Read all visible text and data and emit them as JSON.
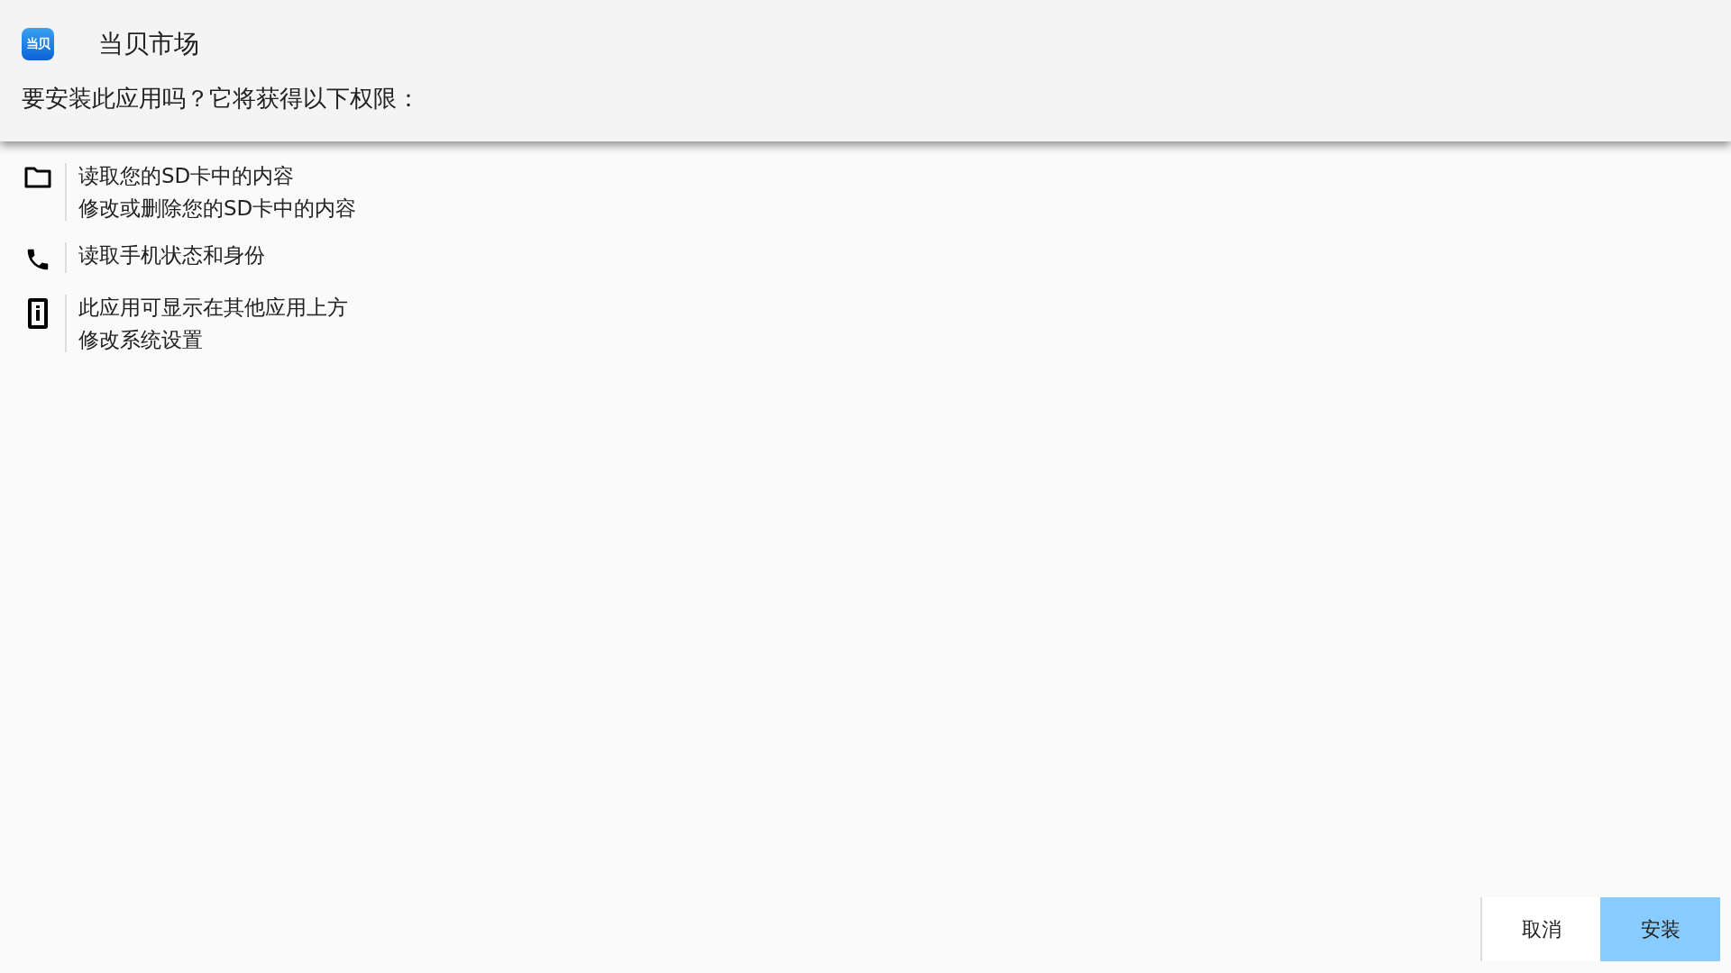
{
  "app": {
    "icon_text": "当贝",
    "name": "当贝市场"
  },
  "prompt": "要安装此应用吗？它将获得以下权限：",
  "permissions": [
    {
      "kind": "storage",
      "lines": [
        "读取您的SD卡中的内容",
        "修改或删除您的SD卡中的内容"
      ]
    },
    {
      "kind": "phone",
      "lines": [
        "读取手机状态和身份"
      ]
    },
    {
      "kind": "device",
      "lines": [
        "此应用可显示在其他应用上方",
        "修改系统设置"
      ]
    }
  ],
  "buttons": [
    {
      "label": "取消",
      "selected": false
    },
    {
      "label": "安装",
      "selected": true
    }
  ]
}
